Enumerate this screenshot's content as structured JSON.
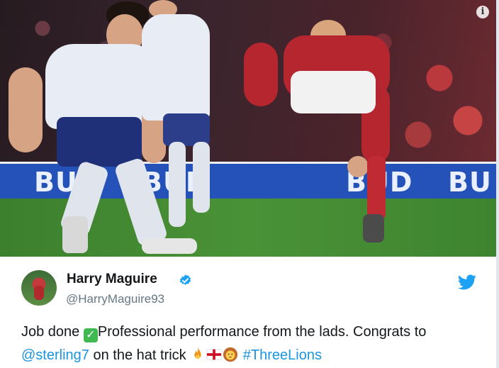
{
  "colors": {
    "link": "#1b95e0",
    "handle": "#657786",
    "twitter_blue": "#1da1f2",
    "verified": "#1da1f2"
  },
  "media": {
    "board_text": [
      "BUD",
      "BUD",
      "BUD",
      "BU"
    ],
    "info_icon": "info-icon"
  },
  "tweet": {
    "author_name": "Harry Maguire",
    "handle": "@HarryMaguire93",
    "verified_icon": "verified-badge-icon",
    "brand_icon": "twitter-bird-icon",
    "text_part1": "Job done ",
    "text_part2": "Professional performance from the lads. Congrats to ",
    "mention": "@sterling7",
    "text_part3": " on the hat trick ",
    "hashtag": "#ThreeLions",
    "emojis": [
      "check-mark-emoji",
      "fire-emoji",
      "england-flag-emoji",
      "lion-emoji"
    ]
  }
}
